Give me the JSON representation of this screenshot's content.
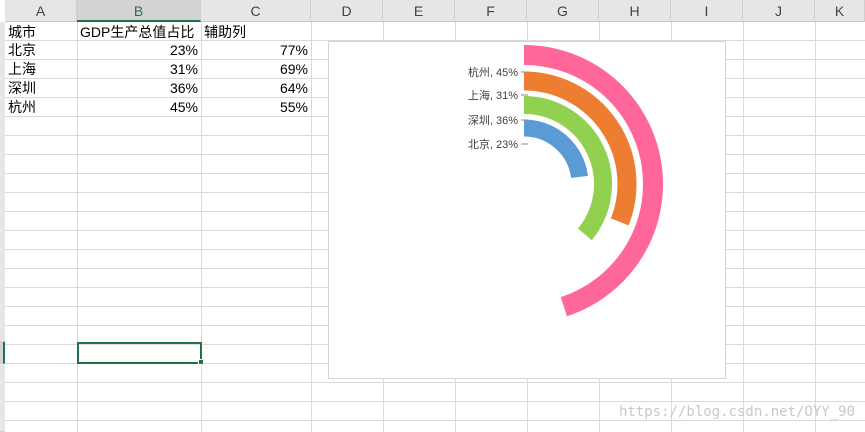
{
  "columns": [
    "A",
    "B",
    "C",
    "D",
    "E",
    "F",
    "G",
    "H",
    "I",
    "J",
    "K"
  ],
  "selected_column": "B",
  "headers": {
    "city": "城市",
    "gdp_share": "GDP生产总值占比",
    "helper": "辅助列"
  },
  "rows": [
    {
      "city": "北京",
      "gdp_share": "23%",
      "helper": "77%"
    },
    {
      "city": "上海",
      "gdp_share": "31%",
      "helper": "69%"
    },
    {
      "city": "深圳",
      "gdp_share": "36%",
      "helper": "64%"
    },
    {
      "city": "杭州",
      "gdp_share": "45%",
      "helper": "55%"
    }
  ],
  "chart_data": {
    "type": "doughnut",
    "series": [
      {
        "name": "北京",
        "value": 0.23,
        "label": "北京, 23%",
        "color": "#5b9bd5"
      },
      {
        "name": "深圳",
        "value": 0.36,
        "label": "深圳, 36%",
        "color": "#92d050"
      },
      {
        "name": "上海",
        "value": 0.31,
        "label": "上海, 31%",
        "color": "#ed7d31"
      },
      {
        "name": "杭州",
        "value": 0.45,
        "label": "杭州, 45%",
        "color": "#ff6699"
      }
    ]
  },
  "watermark": "https://blog.csdn.net/OYY_90"
}
